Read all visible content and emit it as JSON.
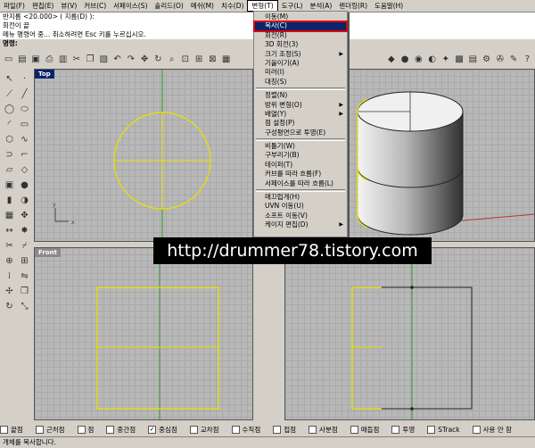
{
  "menubar": {
    "items": [
      "파일(F)",
      "편집(E)",
      "뷰(V)",
      "커브(C)",
      "서페이스(S)",
      "솔리드(O)",
      "메쉬(M)",
      "치수(D)",
      "변형(T)",
      "도구(L)",
      "분석(A)",
      "렌더링(R)",
      "도움말(H)"
    ],
    "active_index": 8
  },
  "command_history": [
    "반지름 <20.000> ( 지름(D) ):",
    "회전이 끝",
    "메뉴 명령어 중... 취소하려면 Esc 키를 누르십시오."
  ],
  "command_prompt": "명령:",
  "dropdown": {
    "items": [
      {
        "label": "이동(M)",
        "arrow": false
      },
      {
        "label": "복사(C)",
        "arrow": false,
        "selected": true
      },
      {
        "label": "회전(R)",
        "arrow": false
      },
      {
        "label": "3D 회전(3)",
        "arrow": false
      },
      {
        "label": "크기 조정(S)",
        "arrow": true
      },
      {
        "label": "기울이기(A)",
        "arrow": false
      },
      {
        "label": "미러(I)",
        "arrow": false
      },
      {
        "label": "대칭(S)",
        "arrow": false
      },
      {
        "sep": true
      },
      {
        "label": "정렬(N)",
        "arrow": false
      },
      {
        "label": "방위 변형(O)",
        "arrow": true
      },
      {
        "label": "배열(Y)",
        "arrow": true
      },
      {
        "label": "점 설정(P)",
        "arrow": false
      },
      {
        "label": "구성평면으로 투영(E)",
        "arrow": false
      },
      {
        "sep": true
      },
      {
        "label": "비틀기(W)",
        "arrow": false
      },
      {
        "label": "구부리기(B)",
        "arrow": false
      },
      {
        "label": "테이퍼(T)",
        "arrow": false
      },
      {
        "label": "커브를 따라 흐름(F)",
        "arrow": false
      },
      {
        "label": "서페이스를 따라 흐름(L)",
        "arrow": false
      },
      {
        "sep": true
      },
      {
        "label": "매끄럽게(H)",
        "arrow": false
      },
      {
        "label": "UVN 이동(U)",
        "arrow": false
      },
      {
        "label": "소프트 이동(V)",
        "arrow": false
      },
      {
        "label": "케이지 편집(D)",
        "arrow": true
      }
    ]
  },
  "viewports": {
    "top": {
      "label": "Top"
    },
    "front": {
      "label": "Front"
    }
  },
  "watermark": "http://drummer78.tistory.com",
  "osnap": [
    {
      "label": "끝점",
      "checked": false
    },
    {
      "label": "근처점",
      "checked": false
    },
    {
      "label": "점",
      "checked": false
    },
    {
      "label": "중간점",
      "checked": false
    },
    {
      "label": "중심점",
      "checked": true
    },
    {
      "label": "교차점",
      "checked": false
    },
    {
      "label": "수직점",
      "checked": false
    },
    {
      "label": "접점",
      "checked": false
    },
    {
      "label": "사분점",
      "checked": false
    },
    {
      "label": "매듭점",
      "checked": false
    },
    {
      "label": "투영",
      "checked": false
    },
    {
      "label": "STrack",
      "checked": false
    },
    {
      "label": "사용 안 함",
      "checked": false
    }
  ],
  "status": "개체를 복사합니다.",
  "colors": {
    "selection": "#0a246a",
    "highlight_border": "#e00000",
    "curve": "#e8e000",
    "axis_y": "#2a9a2a",
    "axis_x": "#c03030"
  }
}
